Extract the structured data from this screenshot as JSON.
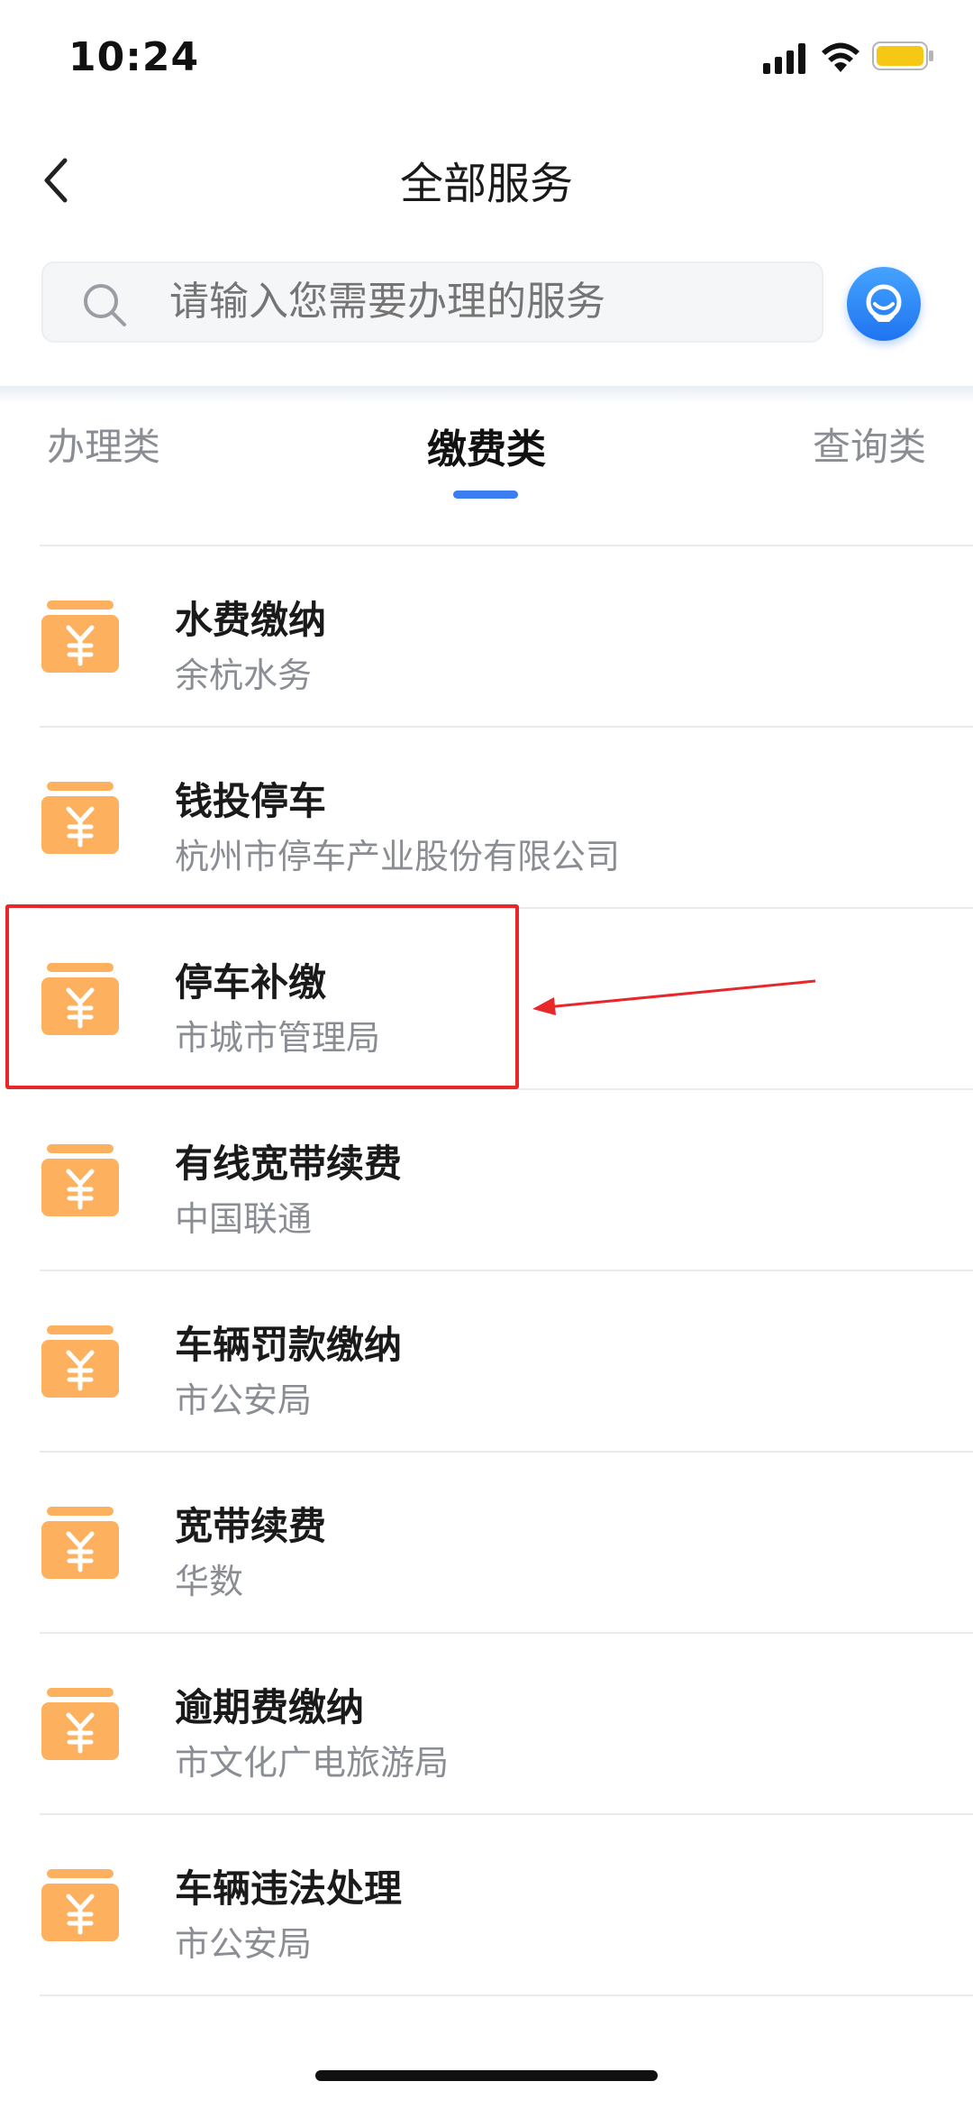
{
  "status_bar": {
    "time": "10:24"
  },
  "header": {
    "title": "全部服务"
  },
  "search": {
    "placeholder": "请输入您需要办理的服务"
  },
  "tabs": [
    {
      "label": "办理类",
      "active": false
    },
    {
      "label": "缴费类",
      "active": true
    },
    {
      "label": "查询类",
      "active": false
    }
  ],
  "services": [
    {
      "title": "水费缴纳",
      "subtitle": "余杭水务"
    },
    {
      "title": "钱投停车",
      "subtitle": "杭州市停车产业股份有限公司"
    },
    {
      "title": "停车补缴",
      "subtitle": "市城市管理局"
    },
    {
      "title": "有线宽带续费",
      "subtitle": "中国联通"
    },
    {
      "title": "车辆罚款缴纳",
      "subtitle": "市公安局"
    },
    {
      "title": "宽带续费",
      "subtitle": "华数"
    },
    {
      "title": "逾期费缴纳",
      "subtitle": "市文化广电旅游局"
    },
    {
      "title": "车辆违法处理",
      "subtitle": "市公安局"
    }
  ],
  "colors": {
    "accent": "#3a7ef0",
    "service_icon": "#fdb15f",
    "annotation": "#e8272a"
  }
}
